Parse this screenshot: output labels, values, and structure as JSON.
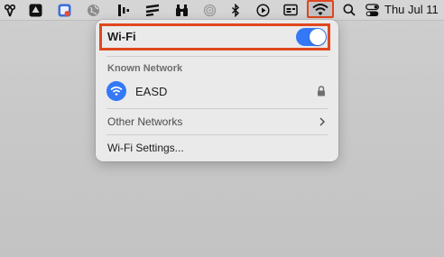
{
  "menubar": {
    "clock": "Thu Jul 11",
    "icons": [
      "scissors-icon",
      "drive-icon",
      "screenshot-icon",
      "globe-icon",
      "audio-bars-icon",
      "sliders-icon",
      "binoculars-icon",
      "airdrop-icon",
      "bluetooth-icon",
      "play-icon",
      "screen-mirror-icon",
      "wifi-icon",
      "search-icon",
      "control-center-icon"
    ]
  },
  "wifi_menu": {
    "title": "Wi-Fi",
    "enabled": true,
    "known_networks_label": "Known Network",
    "known_networks": [
      {
        "name": "EASD",
        "locked": true
      }
    ],
    "other_networks_label": "Other Networks",
    "settings_label": "Wi-Fi Settings..."
  },
  "colors": {
    "accent": "#3478f6",
    "highlight": "#e0471f"
  }
}
